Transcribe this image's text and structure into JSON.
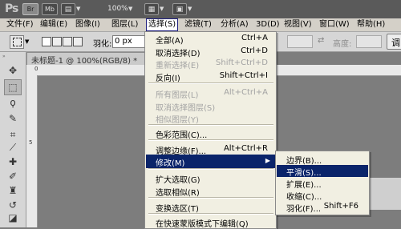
{
  "appbar": {
    "logo": "Ps",
    "br_label": "Br",
    "mb_label": "Mb",
    "zoom": "100%"
  },
  "menubar": {
    "items": [
      {
        "label": "文件(F)"
      },
      {
        "label": "编辑(E)"
      },
      {
        "label": "图像(I)"
      },
      {
        "label": "图层(L)"
      },
      {
        "label": "选择(S)"
      },
      {
        "label": "滤镜(T)"
      },
      {
        "label": "分析(A)"
      },
      {
        "label": "3D(D)"
      },
      {
        "label": "视图(V)"
      },
      {
        "label": "窗口(W)"
      },
      {
        "label": "帮助(H)"
      }
    ]
  },
  "options": {
    "feather_label": "羽化:",
    "feather_value": "0 px",
    "height_label": "高度:",
    "refine_button": "调"
  },
  "document": {
    "tab_title": "未标题-1 @ 100%(RGB/8) *",
    "ruler_top_marks": [
      "0"
    ],
    "ruler_left_marks": [
      "5"
    ]
  },
  "select_menu": {
    "items": [
      {
        "label": "全部(A)",
        "shortcut": "Ctrl+A",
        "enabled": true
      },
      {
        "label": "取消选择(D)",
        "shortcut": "Ctrl+D",
        "enabled": true
      },
      {
        "label": "重新选择(E)",
        "shortcut": "Shift+Ctrl+D",
        "enabled": false
      },
      {
        "label": "反向(I)",
        "shortcut": "Shift+Ctrl+I",
        "enabled": true
      },
      {
        "label": "所有图层(L)",
        "shortcut": "Alt+Ctrl+A",
        "enabled": false
      },
      {
        "label": "取消选择图层(S)",
        "shortcut": "",
        "enabled": false
      },
      {
        "label": "相似图层(Y)",
        "shortcut": "",
        "enabled": false
      },
      {
        "label": "色彩范围(C)...",
        "shortcut": "",
        "enabled": true
      },
      {
        "label": "调整边缘(F)...",
        "shortcut": "Alt+Ctrl+R",
        "enabled": true
      },
      {
        "label": "修改(M)",
        "shortcut": "",
        "enabled": true,
        "highlighted": true
      },
      {
        "label": "扩大选取(G)",
        "shortcut": "",
        "enabled": true
      },
      {
        "label": "选取相似(R)",
        "shortcut": "",
        "enabled": true
      },
      {
        "label": "变换选区(T)",
        "shortcut": "",
        "enabled": true
      },
      {
        "label": "在快速蒙版模式下编辑(Q)",
        "shortcut": "",
        "enabled": true
      }
    ]
  },
  "modify_submenu": {
    "items": [
      {
        "label": "边界(B)...",
        "shortcut": ""
      },
      {
        "label": "平滑(S)...",
        "shortcut": "",
        "highlighted": true
      },
      {
        "label": "扩展(E)...",
        "shortcut": ""
      },
      {
        "label": "收缩(C)...",
        "shortcut": ""
      },
      {
        "label": "羽化(F)...",
        "shortcut": "Shift+F6"
      }
    ]
  },
  "icons": {
    "toolbar": [
      "move-icon",
      "marquee-icon",
      "lasso-icon",
      "quick-select-icon",
      "crop-icon",
      "eyedropper-icon",
      "healing-brush-icon",
      "brush-icon",
      "clone-stamp-icon",
      "history-brush-icon",
      "eraser-icon",
      "gradient-icon"
    ]
  },
  "colors": {
    "menu_highlight": "#0a246a",
    "menu_bg": "#f1efe2",
    "disabled_text": "#a3a3a3",
    "appbar_bg": "#5a5a5a"
  }
}
